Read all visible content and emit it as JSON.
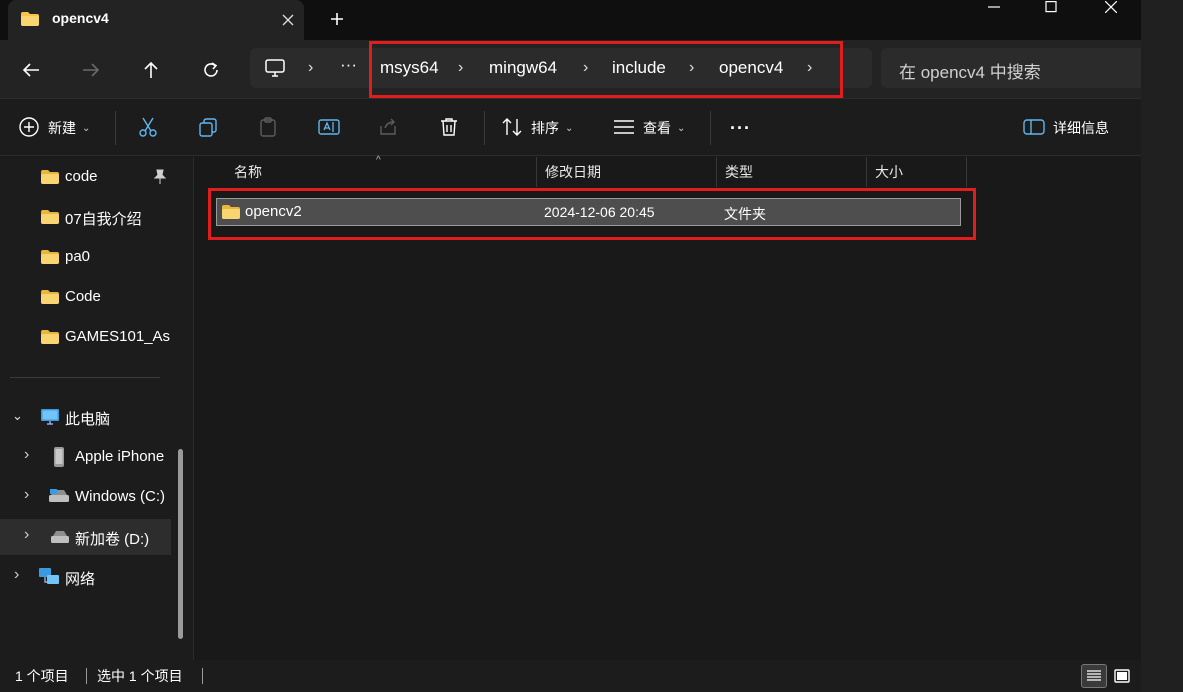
{
  "window": {
    "tab_title": "opencv4",
    "new_tab_glyph": "+",
    "close_tab_glyph": "✕"
  },
  "address": {
    "ellipsis": "···",
    "crumbs": [
      "msys64",
      "mingw64",
      "include",
      "opencv4"
    ],
    "search_placeholder": "在 opencv4 中搜索"
  },
  "toolbar": {
    "new_label": "新建",
    "sort_label": "排序",
    "view_label": "查看",
    "more_label": "···",
    "details_label": "详细信息"
  },
  "sidebar": {
    "quick_access": [
      {
        "label": "code",
        "pinned": true
      },
      {
        "label": "07自我介绍"
      },
      {
        "label": "pa0"
      },
      {
        "label": "Code"
      },
      {
        "label": "GAMES101_As"
      }
    ],
    "this_pc": "此电脑",
    "devices": [
      {
        "label": "Apple iPhone",
        "icon": "phone-icon"
      },
      {
        "label": "Windows (C:)",
        "icon": "drive-icon"
      },
      {
        "label": "新加卷 (D:)",
        "icon": "drive-icon"
      }
    ],
    "network": "网络"
  },
  "columns": {
    "name": "名称",
    "modified": "修改日期",
    "type": "类型",
    "size": "大小"
  },
  "files": [
    {
      "name": "opencv2",
      "modified": "2024-12-06 20:45",
      "type": "文件夹",
      "size": ""
    }
  ],
  "status": {
    "count": "1 个项目",
    "selected": "选中 1 个项目"
  },
  "colors": {
    "highlight_box": "#e01e1e",
    "folder": "#f3c54a",
    "background": "#191919"
  }
}
